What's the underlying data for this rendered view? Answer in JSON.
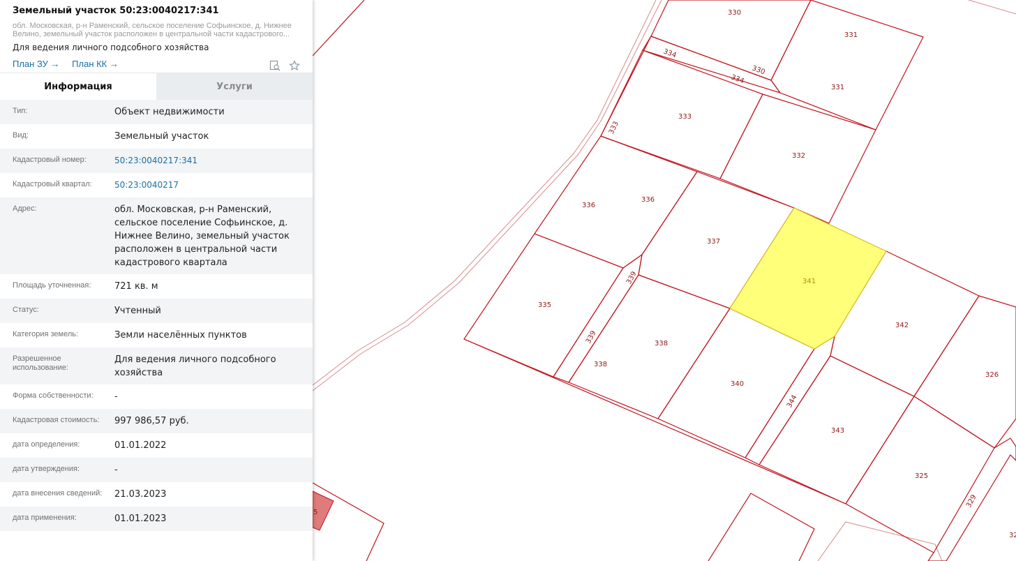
{
  "panel": {
    "title": "Земельный участок 50:23:0040217:341",
    "address_short": "обл. Московская, р-н Раменский, сельское поселение Софьинское, д. Нижнее Велино, земельный участок расположен в центральной части кадастрового...",
    "purpose": "Для ведения личного подсобного хозяйства",
    "link_plan_zu": "План ЗУ →",
    "link_plan_kk": "План КК →",
    "tabs": [
      {
        "label": "Информация",
        "active": true
      },
      {
        "label": "Услуги",
        "active": false
      }
    ],
    "rows": [
      {
        "key": "Тип:",
        "value": "Объект недвижимости"
      },
      {
        "key": "Вид:",
        "value": "Земельный участок"
      },
      {
        "key": "Кадастровый номер:",
        "value": "50:23:0040217:341",
        "link": true
      },
      {
        "key": "Кадастровый квартал:",
        "value": "50:23:0040217",
        "link": true
      },
      {
        "key": "Адрес:",
        "value": "обл. Московская, р-н Раменский, сельское поселение Софьинское, д. Нижнее Велино, земельный участок расположен в центральной части кадастрового квартала"
      },
      {
        "key": "Площадь уточненная:",
        "value": "721 кв. м"
      },
      {
        "key": "Статус:",
        "value": "Учтенный"
      },
      {
        "key": "Категория земель:",
        "value": "Земли населённых пунктов"
      },
      {
        "key": "Разрешенное использование:",
        "value": "Для ведения личного подсобного хозяйства"
      },
      {
        "key": "Форма собственности:",
        "value": "-"
      },
      {
        "key": "Кадастровая стоимость:",
        "value": "997 986,57 руб."
      },
      {
        "key": "дата определения:",
        "value": "01.01.2022"
      },
      {
        "key": "дата утверждения:",
        "value": "-"
      },
      {
        "key": "дата внесения сведений:",
        "value": "21.03.2023"
      },
      {
        "key": "дата применения:",
        "value": "01.01.2023"
      }
    ]
  },
  "map": {
    "colors": {
      "boundary": "#c0141e",
      "road": "#d98a8a",
      "highlight_fill": "#ffff7a",
      "highlight_stroke": "#d8c020",
      "label": "#8b1a1a",
      "red_parcel": "#e07b7b"
    },
    "labels": [
      "330",
      "331",
      "334",
      "330",
      "334",
      "331",
      "333",
      "333",
      "332",
      "336",
      "336",
      "337",
      "341",
      "339",
      "335",
      "339",
      "338",
      "338",
      "342",
      "340",
      "326",
      "344",
      "343",
      "325",
      "329",
      "32",
      "5"
    ]
  }
}
